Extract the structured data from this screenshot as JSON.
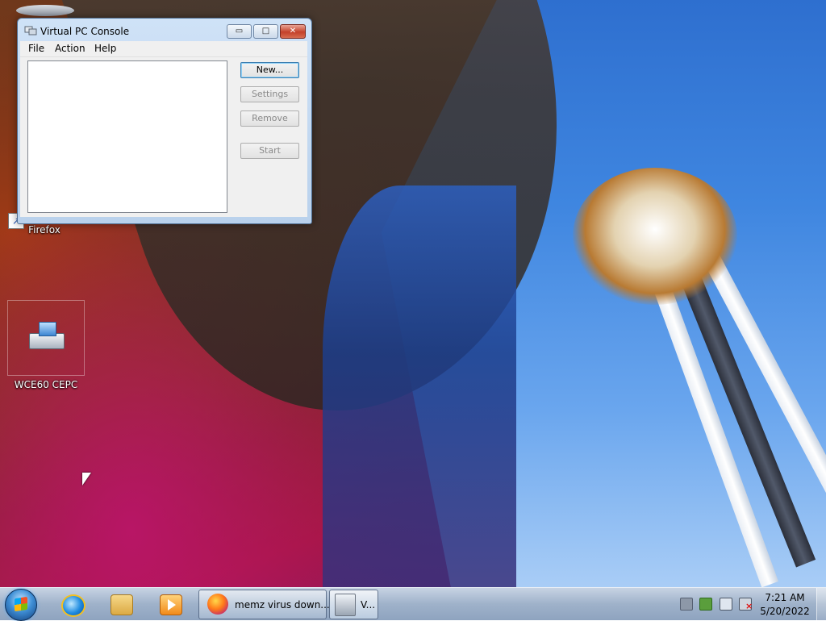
{
  "desktop": {
    "icons": [
      {
        "label": "Firefox",
        "icon": "firefox-shortcut-icon"
      },
      {
        "label": "WCE60 CEPC",
        "icon": "virtual-machine-icon"
      }
    ]
  },
  "window": {
    "title": "Virtual PC Console",
    "title_icon": "virtual-pc-icon",
    "controls": {
      "minimize": "▭",
      "maximize": "□",
      "close": "✕"
    },
    "menu": [
      "File",
      "Action",
      "Help"
    ],
    "buttons": {
      "new": "New...",
      "settings": "Settings",
      "remove": "Remove",
      "start": "Start"
    },
    "vm_list_items": []
  },
  "taskbar": {
    "pinned": [
      "internet-explorer-icon",
      "windows-explorer-icon",
      "media-player-icon"
    ],
    "tasks": [
      {
        "label": "memz virus down...",
        "icon": "firefox-icon"
      },
      {
        "label": "V...",
        "icon": "virtual-pc-icon"
      }
    ],
    "tray_icons": [
      "network-device-icon",
      "action-center-icon",
      "network-icon",
      "volume-muted-icon"
    ],
    "clock": {
      "time": "7:21 AM",
      "date": "5/20/2022"
    }
  }
}
